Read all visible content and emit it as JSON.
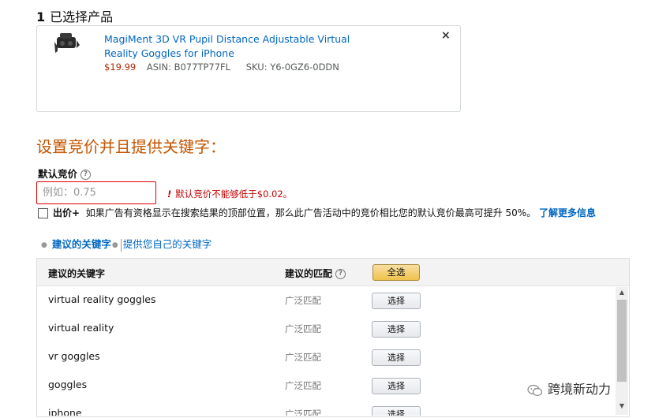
{
  "selection": {
    "count": "1",
    "label": "已选择产品"
  },
  "product": {
    "title": "MagiMent 3D VR Pupil Distance Adjustable Virtual Reality Goggles for iPhone",
    "price": "$19.99",
    "asin": "ASIN: B077TP77FL",
    "sku": "SKU: Y6-0GZ6-0DDN",
    "remove_icon": "×"
  },
  "section_title": "设置竞价并且提供关键字：",
  "default_bid": {
    "label": "默认竞价",
    "help_icon": "?",
    "input_value": "",
    "placeholder": "例如：0.75",
    "error_icon": "!",
    "error_text": "默认竞价不能够低于$0.02。"
  },
  "bid_plus": {
    "label": "出价+",
    "description": "如果广告有资格显示在搜索结果的顶部位置，那么此广告活动中的竞价相比您的默认竞价最高可提升 50%。",
    "link": "了解更多信息",
    "checked": false
  },
  "keyword_tabs": [
    {
      "label": "建议的关键字",
      "active": true
    },
    {
      "label": "提供您自己的关键字",
      "active": false
    }
  ],
  "keyword_table": {
    "columns": {
      "keyword": "建议的关键字",
      "match": "建议的匹配",
      "select_all": "全选"
    },
    "rows": [
      {
        "keyword": "virtual reality goggles",
        "match": "广泛匹配",
        "action": "选择"
      },
      {
        "keyword": "virtual reality",
        "match": "广泛匹配",
        "action": "选择"
      },
      {
        "keyword": "vr goggles",
        "match": "广泛匹配",
        "action": "选择"
      },
      {
        "keyword": "goggles",
        "match": "广泛匹配",
        "action": "选择"
      },
      {
        "keyword": "iphone",
        "match": "广泛匹配",
        "action": "选择"
      }
    ]
  },
  "watermark": {
    "text": "跨境新动力",
    "icon": "wechat-icon"
  },
  "colors": {
    "accent_orange": "#c45500",
    "link_blue": "#0066c0",
    "error_red": "#c40000",
    "button_yellow": "#f0c14b"
  }
}
